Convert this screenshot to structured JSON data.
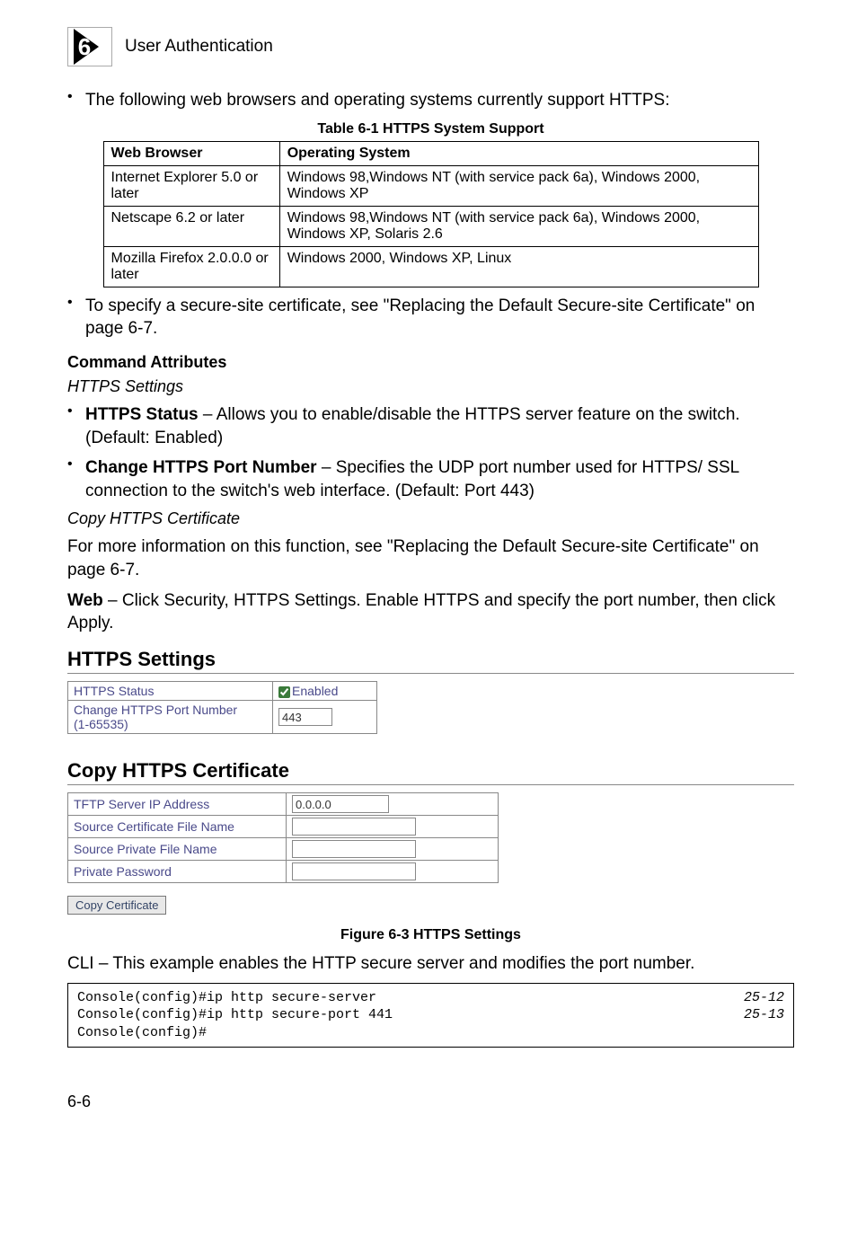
{
  "header": {
    "chapter_num": "6",
    "title": "User Authentication"
  },
  "intro_bullet": "The following web browsers and operating systems currently support HTTPS:",
  "table1": {
    "caption": "Table 6-1  HTTPS System Support",
    "headers": [
      "Web Browser",
      "Operating System"
    ],
    "rows": [
      [
        "Internet Explorer 5.0 or later",
        "Windows 98,Windows NT (with service pack 6a), Windows 2000, Windows XP"
      ],
      [
        "Netscape 6.2 or later",
        "Windows 98,Windows NT (with service pack 6a), Windows 2000, Windows XP, Solaris 2.6"
      ],
      [
        "Mozilla Firefox 2.0.0.0 or later",
        "Windows 2000, Windows XP, Linux"
      ]
    ]
  },
  "secure_site_bullet": "To specify a secure-site certificate, see \"Replacing the Default Secure-site Certificate\" on page 6-7.",
  "cmd_attr_heading": "Command Attributes",
  "https_settings_sub": "HTTPS Settings",
  "bullets2": [
    {
      "bold": "HTTPS Status",
      "rest": " – Allows you to enable/disable the HTTPS server feature on the switch. (Default: Enabled)"
    },
    {
      "bold": "Change HTTPS Port Number",
      "rest": " – Specifies the UDP port number used for HTTPS/ SSL connection to the switch's web interface. (Default: Port 443)"
    }
  ],
  "copy_cert_sub": "Copy HTTPS Certificate",
  "copy_cert_para": "For more information on this function, see \"Replacing the Default Secure-site Certificate\" on page 6-7.",
  "web_para_bold": "Web",
  "web_para_rest": " – Click Security, HTTPS Settings. Enable HTTPS and specify the port number, then click Apply.",
  "screenshot": {
    "https_heading": "HTTPS Settings",
    "status_label": "HTTPS Status",
    "enabled_label": "Enabled",
    "port_label_l1": "Change HTTPS Port Number",
    "port_label_l2": "(1-65535)",
    "port_value": "443",
    "copy_heading": "Copy HTTPS Certificate",
    "tftp_label": "TFTP Server IP Address",
    "tftp_value": "0.0.0.0",
    "src_cert_label": "Source Certificate File Name",
    "src_priv_label": "Source Private File Name",
    "priv_pw_label": "Private Password",
    "button": "Copy Certificate"
  },
  "figure_caption": "Figure 6-3  HTTPS Settings",
  "cli_intro": "CLI – This example enables the HTTP secure server and modifies the port number.",
  "cli": {
    "lines": [
      {
        "cmd": "Console(config)#ip http secure-server",
        "ref": "25-12"
      },
      {
        "cmd": "Console(config)#ip http secure-port 441",
        "ref": "25-13"
      },
      {
        "cmd": "Console(config)#",
        "ref": ""
      }
    ]
  },
  "pagenum": "6-6"
}
